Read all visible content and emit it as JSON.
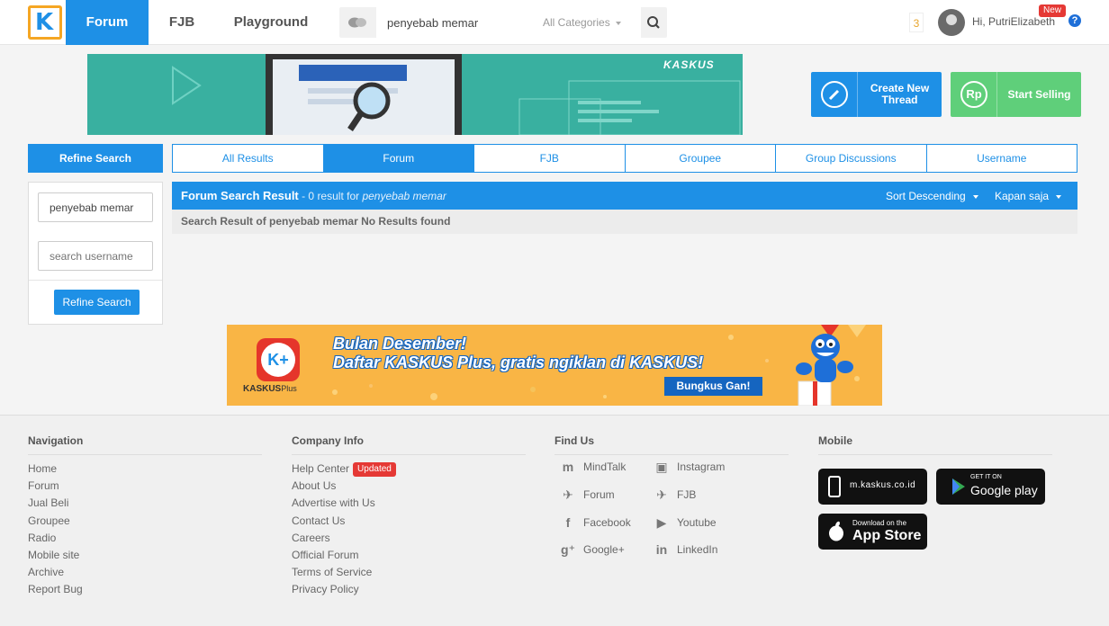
{
  "header": {
    "logo_letter": "K",
    "nav": [
      "Forum",
      "FJB",
      "Playground"
    ],
    "search": {
      "value": "penyebab memar",
      "category": "All Categories"
    },
    "notification_count": "3",
    "greeting": "Hi, PutriElizabeth",
    "new_badge": "New",
    "help": "?"
  },
  "banner_top": {
    "brand": "KASKUS"
  },
  "actions": {
    "create_line1": "Create New",
    "create_line2": "Thread",
    "sell": "Start Selling",
    "sell_icon_text": "Rp"
  },
  "refine": {
    "title": "Refine Search",
    "keyword_value": "penyebab memar",
    "username_placeholder": "search username",
    "button": "Refine Search"
  },
  "tabs": [
    "All Results",
    "Forum",
    "FJB",
    "Groupee",
    "Group Discussions",
    "Username"
  ],
  "active_tab": "Forum",
  "results": {
    "title": "Forum Search Result",
    "summary_prefix": " - 0 result for ",
    "query": "penyebab memar",
    "sort": "Sort Descending",
    "time": "Kapan saja",
    "empty_message": "Search Result of penyebab memar No Results found"
  },
  "banner_bottom": {
    "line1": "Bulan Desember!",
    "line2": "Daftar KASKUS Plus, gratis ngiklan di KASKUS!",
    "cta": "Bungkus Gan!",
    "brand": "KASKUS",
    "brand_plus": "Plus"
  },
  "footer": {
    "navigation": {
      "title": "Navigation",
      "links": [
        "Home",
        "Forum",
        "Jual Beli",
        "Groupee",
        "Radio",
        "Mobile site",
        "Archive",
        "Report Bug"
      ]
    },
    "company": {
      "title": "Company Info",
      "links": [
        "Help Center",
        "About Us",
        "Advertise with Us",
        "Contact Us",
        "Careers",
        "Official Forum",
        "Terms of Service",
        "Privacy Policy"
      ],
      "updated_badge": "Updated"
    },
    "findus": {
      "title": "Find Us",
      "items": [
        {
          "label": "MindTalk",
          "icon": "mindtalk-icon"
        },
        {
          "label": "Instagram",
          "icon": "instagram-icon"
        },
        {
          "label": "Forum",
          "icon": "twitter-icon"
        },
        {
          "label": "FJB",
          "icon": "twitter-icon"
        },
        {
          "label": "Facebook",
          "icon": "facebook-icon"
        },
        {
          "label": "Youtube",
          "icon": "youtube-icon"
        },
        {
          "label": "Google+",
          "icon": "googleplus-icon"
        },
        {
          "label": "LinkedIn",
          "icon": "linkedin-icon"
        }
      ]
    },
    "mobile": {
      "title": "Mobile",
      "mobile_site": "m.kaskus.co.id",
      "gp_small": "GET IT ON",
      "gp_big": "Google play",
      "as_small": "Download on the",
      "as_big": "App Store"
    }
  },
  "colors": {
    "primary": "#1e90e6",
    "sell": "#5fcf7a",
    "badge": "#e53935",
    "logo_border": "#f5a623"
  }
}
